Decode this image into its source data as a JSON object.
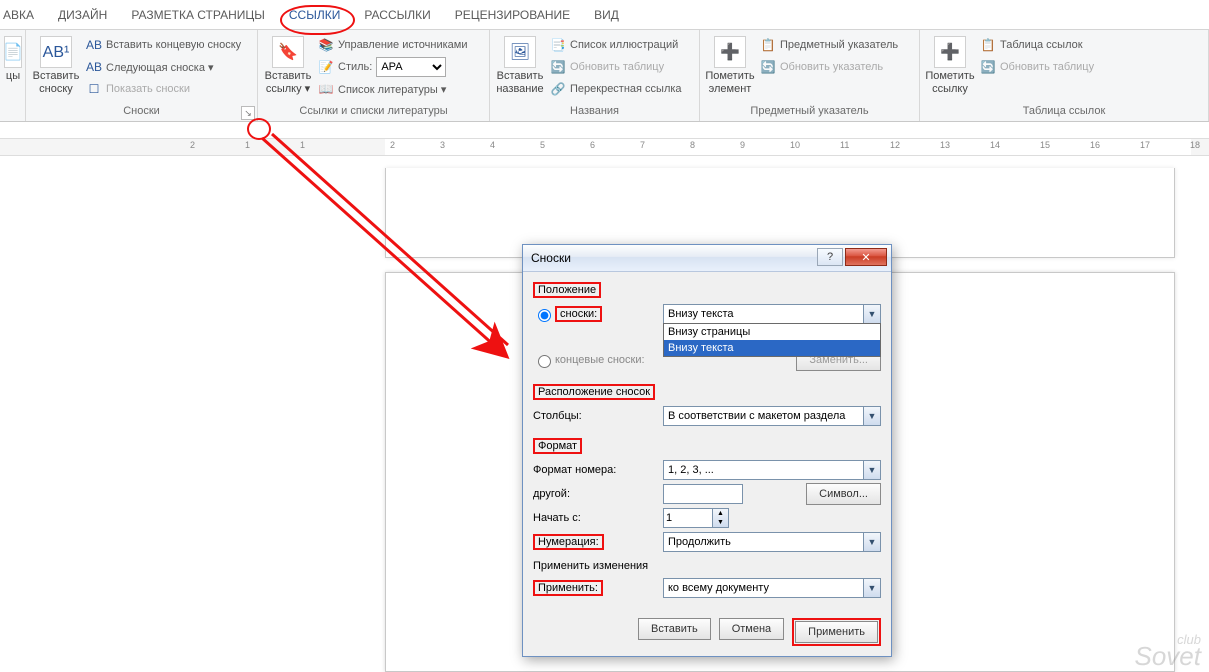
{
  "tabs": {
    "t0": "АВКА",
    "t1": "ДИЗАЙН",
    "t2": "РАЗМЕТКА СТРАНИЦЫ",
    "t3": "ССЫЛКИ",
    "t4": "РАССЫЛКИ",
    "t5": "РЕЦЕНЗИРОВАНИЕ",
    "t6": "ВИД"
  },
  "ribbon": {
    "g_toc": {
      "big": "цы"
    },
    "g_footnotes": {
      "big1": "Вставить",
      "big2": "сноску",
      "r1": "Вставить концевую сноску",
      "r2": "Следующая сноска ▾",
      "r3": "Показать сноски",
      "label": "Сноски"
    },
    "g_citations": {
      "big1": "Вставить",
      "big2": "ссылку ▾",
      "r1": "Управление источниками",
      "r2_label": "Стиль:",
      "r2_value": "APA",
      "r3": "Список литературы ▾",
      "label": "Ссылки и списки литературы"
    },
    "g_captions": {
      "big1": "Вставить",
      "big2": "название",
      "r1": "Список иллюстраций",
      "r2": "Обновить таблицу",
      "r3": "Перекрестная ссылка",
      "label": "Названия"
    },
    "g_index": {
      "big1": "Пометить",
      "big2": "элемент",
      "r1": "Предметный указатель",
      "r2": "Обновить указатель",
      "label": "Предметный указатель"
    },
    "g_toa": {
      "big1": "Пометить",
      "big2": "ссылку",
      "r1": "Таблица ссылок",
      "r2": "Обновить таблицу",
      "label": "Таблица ссылок"
    }
  },
  "ruler_nums": [
    "2",
    "1",
    "1",
    "2",
    "3",
    "4",
    "5",
    "6",
    "7",
    "8",
    "9",
    "10",
    "11",
    "12",
    "13",
    "14",
    "15",
    "16",
    "17",
    "18"
  ],
  "dialog": {
    "title": "Сноски",
    "sec_position": "Положение",
    "opt_footnotes": "сноски:",
    "opt_endnotes": "концевые сноски:",
    "combo_value": "Внизу текста",
    "drop_item1": "Внизу страницы",
    "drop_item2": "Внизу текста",
    "btn_replace": "Заменить...",
    "sec_layout": "Расположение сносок",
    "lbl_columns": "Столбцы:",
    "val_columns": "В соответствии с макетом раздела",
    "sec_format": "Формат",
    "lbl_numfmt": "Формат номера:",
    "val_numfmt": "1, 2, 3, ...",
    "lbl_custom": "другой:",
    "btn_symbol": "Символ...",
    "lbl_start": "Начать с:",
    "val_start": "1",
    "lbl_numbering": "Нумерация:",
    "val_numbering": "Продолжить",
    "lbl_applychanges": "Применить изменения",
    "lbl_apply": "Применить:",
    "val_apply": "ко всему документу",
    "btn_insert": "Вставить",
    "btn_cancel": "Отмена",
    "btn_apply": "Применить"
  },
  "watermark": {
    "small": "club",
    "big": "Sovet"
  }
}
